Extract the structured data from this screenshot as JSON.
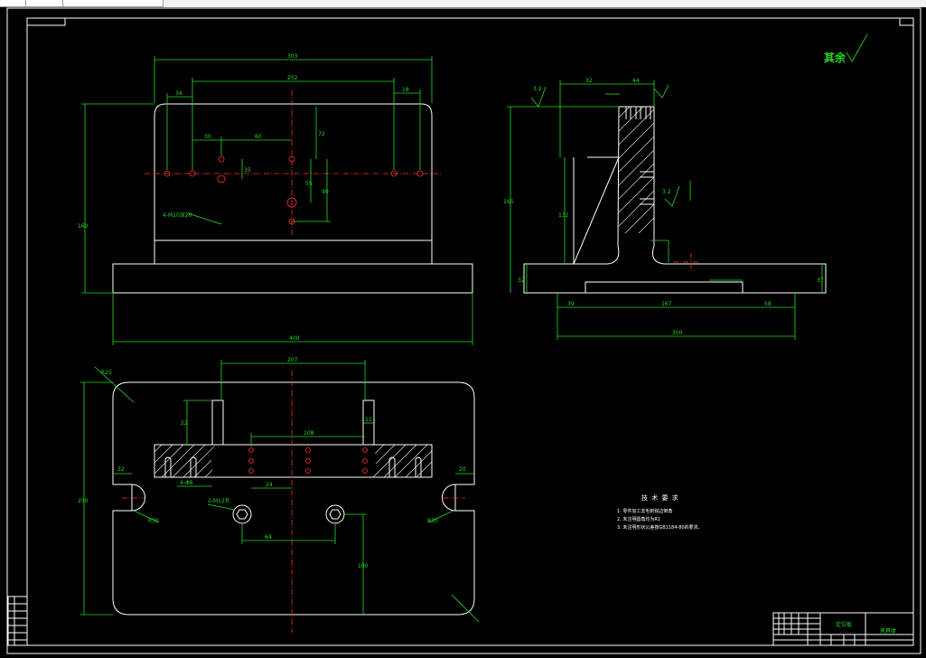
{
  "note": {
    "label": "其余",
    "roughness": "3.2"
  },
  "tech": {
    "title": "技 术 要 求",
    "items": [
      "1. 零件加工去毛刺锐边倒角",
      "2. 未注明圆角均为R1",
      "3. 未注明形状公差按GB1184-80的要求。"
    ]
  },
  "dims": {
    "top_overall": "303",
    "top_inner": "252",
    "top_left": "34",
    "top_right": "18",
    "top_h1": "30",
    "top_h2": "60",
    "top_v1": "35",
    "top_v2": "72",
    "top_v3": "55",
    "top_v4": "90",
    "top_height": "160",
    "top_base": "400",
    "side_a": "32",
    "side_b": "44",
    "side_c": "3.2",
    "side_height": "165",
    "side_inner": "132",
    "side_base": "300",
    "side_left": "39",
    "side_mid": "167",
    "side_right": "58",
    "side_rough": "3.2",
    "side_t": "37",
    "side_t2": "32",
    "bot_top": "207",
    "bot_r": "R25",
    "bot_left": "32",
    "bot_right": "20",
    "bot_h": "250",
    "bot_mid": "108",
    "bot_64": "64",
    "bot_24": "24",
    "bot_100": "100",
    "bot_11": "11",
    "bot_22": "22",
    "bot_446": "4-Φ8",
    "bot_r30a": "R30",
    "bot_r30b": "R30",
    "bot_note": "2-M12孔",
    "hole_note": "4-M10深20"
  },
  "title_block": {
    "name": "定位板",
    "code": "夹具体"
  },
  "colors": {
    "line": "#ffffff",
    "dim": "#22dd22",
    "center": "#ff3030"
  }
}
